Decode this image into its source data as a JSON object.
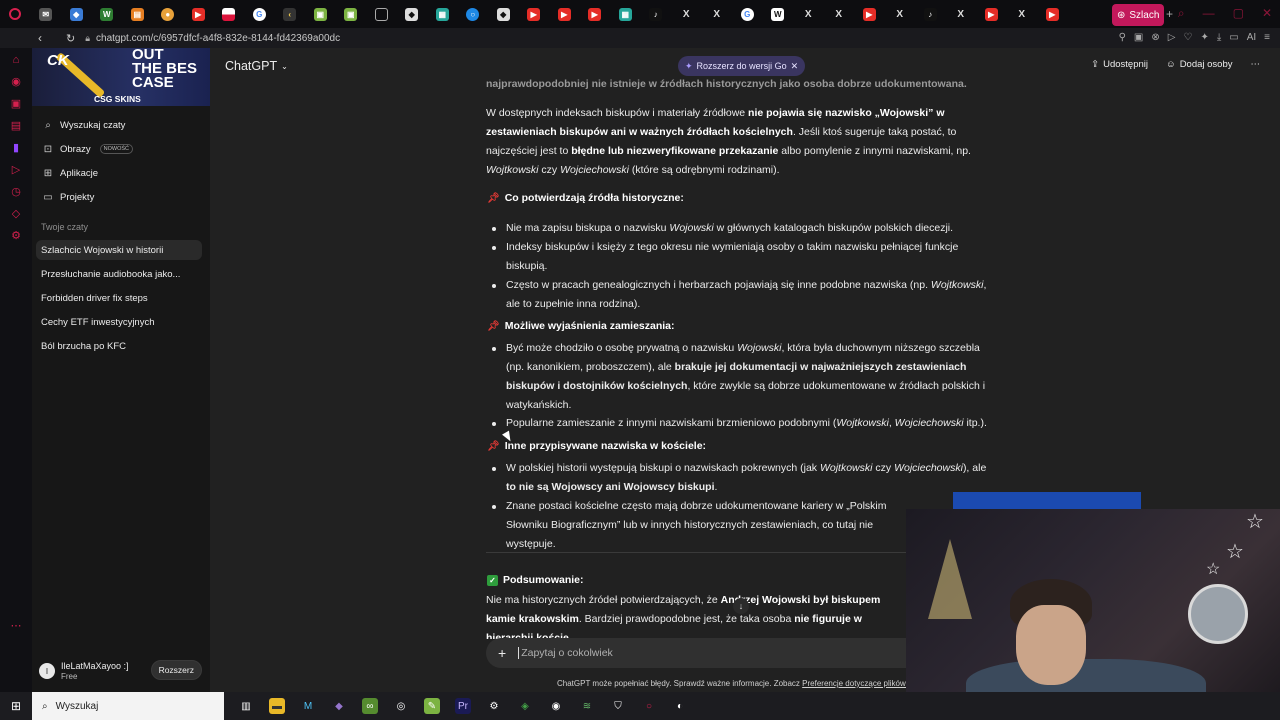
{
  "browser": {
    "active_tab_label": "Szlach",
    "url": "chatgpt.com/c/6957dfcf-a4f8-832e-8144-fd42369a00dc",
    "addr_ai_label": "AI"
  },
  "promo": {
    "line1": "CK",
    "line2": "OUT\nTHE BES\nCASE",
    "brand": "CSG SKINS"
  },
  "sidebar": {
    "items": [
      {
        "label": "Wyszukaj czaty",
        "icon": "search-icon"
      },
      {
        "label": "Obrazy",
        "icon": "image-icon",
        "badge": "NOWOŚĆ"
      },
      {
        "label": "Aplikacje",
        "icon": "apps-icon"
      },
      {
        "label": "Projekty",
        "icon": "folder-icon"
      }
    ],
    "section_label": "Twoje czaty",
    "chats": [
      "Szlachcic Wojowski w historii",
      "Przesłuchanie audiobooka jako...",
      "Forbidden driver fix steps",
      "Cechy ETF inwestycyjnych",
      "Ból brzucha po KFC"
    ],
    "user": {
      "name": "IleLatMaXayoo :]",
      "plan": "Free",
      "initial": "I",
      "upgrade_label": "Rozszerz"
    }
  },
  "header": {
    "model": "ChatGPT",
    "go_pill": "Rozszerz do wersji Go",
    "share": "Udostępnij",
    "add_people": "Dodaj osoby"
  },
  "message": {
    "top_partial": "najprawdopodobniej nie istnieje w źródłach historycznych jako osoba dobrze udokumentowana.",
    "para1_a": "W dostępnych indeksach biskupów i materiały źródłowe ",
    "para1_b": "nie pojawia się nazwisko „Wojowski” w zestawieniach biskupów ani w ważnych źródłach kościelnych",
    "para1_c": ". Jeśli ktoś sugeruje taką postać, to najczęściej jest to ",
    "para1_d": "błędne lub niezweryfikowane przekazanie",
    "para1_e": " albo pomylenie z innymi nazwiskami, np. ",
    "para1_f": "Wojtkowski",
    "para1_g": " czy ",
    "para1_h": "Wojciechowski",
    "para1_i": " (które są odrębnymi rodzinami).",
    "h1": "Co potwierdzają źródła historyczne:",
    "b1_a": "Nie ma zapisu biskupa o nazwisku ",
    "b1_b": "Wojowski",
    "b1_c": " w głównych katalogach biskupów polskich diecezji.",
    "b2": "Indeksy biskupów i księży z tego okresu nie wymieniają osoby o takim nazwisku pełniącej funkcje biskupią.",
    "b3_a": "Często w pracach genealogicznych i herbarzach pojawiają się inne podobne nazwiska (np. ",
    "b3_b": "Wojtkowski",
    "b3_c": ", ale to zupełnie inna rodzina).",
    "h2": "Możliwe wyjaśnienia zamieszania:",
    "b4_a": "Być może chodziło o osobę prywatną o nazwisku ",
    "b4_b": "Wojowski",
    "b4_c": ", która była duchownym niższego szczebla (np. kanonikiem, proboszczem), ale ",
    "b4_d": "brakuje jej dokumentacji w najważniejszych zestawieniach biskupów i dostojników kościelnych",
    "b4_e": ", które zwykle są dobrze udokumentowane w źródłach polskich i watykańskich.",
    "b5_a": "Popularne zamieszanie z innymi nazwiskami brzmieniowo podobnymi (",
    "b5_b": "Wojtkowski",
    "b5_c": ", ",
    "b5_d": "Wojciechowski",
    "b5_e": " itp.).",
    "h3": "Inne przypisywane nazwiska w kościele:",
    "b6_a": "W polskiej historii występują biskupi o nazwiskach pokrewnych (jak ",
    "b6_b": "Wojtkowski",
    "b6_c": " czy ",
    "b6_d": "Wojciechowski",
    "b6_e": "), ale ",
    "b6_f": "to nie są Wojowscy ani Wojowscy biskupi",
    "b6_g": ".",
    "b7": "Znane postaci kościelne często mają dobrze udokumentowane kariery w „Polskim Słowniku Biograficznym” lub w innych historycznych zestawieniach, co tutaj nie występuje.",
    "summary_title": "Podsumowanie:",
    "summary_a": "Nie ma historycznych źródeł potwierdzających, że ",
    "summary_b": "Andrzej Wojowski był biskupem kamie",
    "summary_c": "krakowskim",
    "summary_d": ". Bardziej prawdopodobne jest, że taka osoba ",
    "summary_e": "nie figuruje w hierarchii koście"
  },
  "composer": {
    "placeholder": "Zapytaj o cokolwiek"
  },
  "disclaimer": {
    "text": "ChatGPT może popełniać błędy. Sprawdź ważne informacje. Zobacz ",
    "link": "Preferencje dotyczące plików c"
  },
  "taskbar": {
    "search_placeholder": "Wyszukaj"
  },
  "colors": {
    "accent_tab": "#c2185b",
    "go_pill": "#3a3560",
    "pin": "#e53935",
    "check": "#2e9d3c"
  }
}
